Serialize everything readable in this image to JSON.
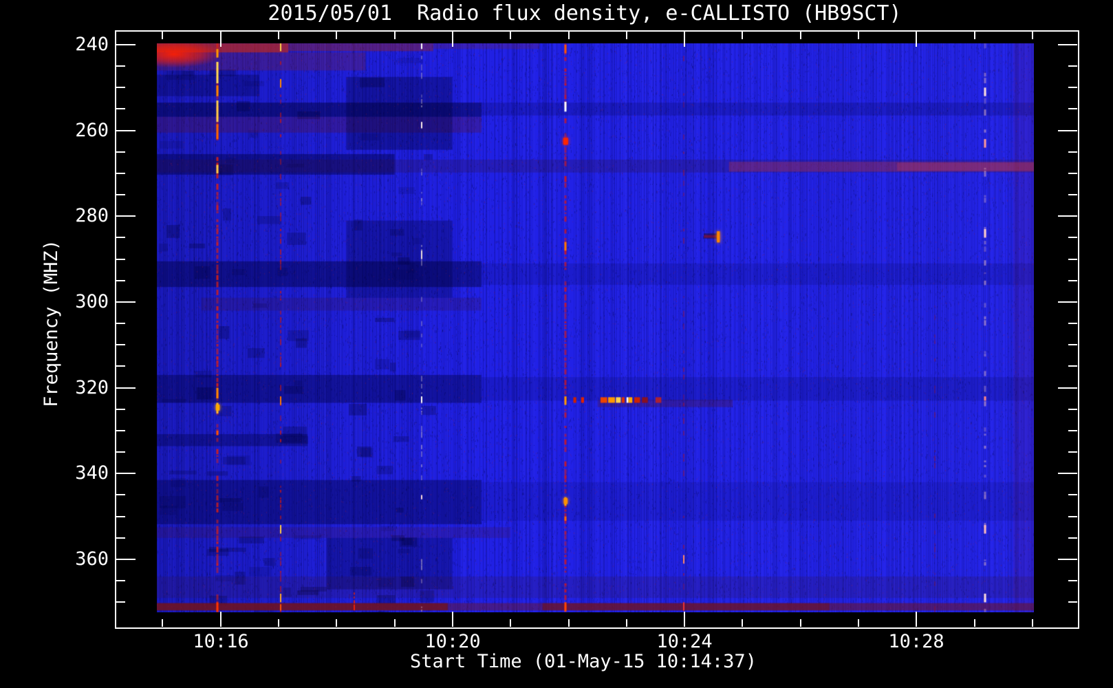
{
  "window": {
    "background": "#000000"
  },
  "chart_data": {
    "type": "heatmap",
    "title": "2015/05/01  Radio flux density, e-CALLISTO (HB9SCT)",
    "xlabel": "Start Time (01-May-15 10:14:37)",
    "ylabel": "Frequency (MHZ)",
    "station": "HB9SCT",
    "date": "2015/05/01",
    "start_time": "10:14:37",
    "background": "#2121e6",
    "x_ticks": [
      {
        "t": "10:16:00",
        "label": "10:16"
      },
      {
        "t": "10:20:00",
        "label": "10:20"
      },
      {
        "t": "10:24:00",
        "label": "10:24"
      },
      {
        "t": "10:28:00",
        "label": "10:28"
      }
    ],
    "x_minor": {
      "start": "10:15:00",
      "end": "10:30:00",
      "step_s": 60
    },
    "y_ticks": [
      {
        "f": 240,
        "label": "240"
      },
      {
        "f": 260,
        "label": "260"
      },
      {
        "f": 280,
        "label": "280"
      },
      {
        "f": 300,
        "label": "300"
      },
      {
        "f": 320,
        "label": "320"
      },
      {
        "f": 340,
        "label": "340"
      },
      {
        "f": 360,
        "label": "360"
      }
    ],
    "y_minor": {
      "start": 245,
      "end": 370,
      "step": 5
    },
    "y_range_mhz": [
      236.8,
      375.9
    ],
    "data_extent": {
      "t0": "10:14:54",
      "t1": "10:30:02",
      "f0": 239.7,
      "f1": 372.4
    },
    "blob": {
      "t": "10:15:12",
      "f": 242.2,
      "rx_s": 50,
      "ry_mhz": 3.2,
      "color": "#ff2000"
    },
    "bands": [
      {
        "t0": "10:14:54",
        "t1": "10:17:10",
        "f0": 239.7,
        "f1": 241.8,
        "color": "#c32611",
        "alpha": 0.7
      },
      {
        "t0": "10:17:10",
        "t1": "10:19:40",
        "f0": 239.7,
        "f1": 241.5,
        "color": "#a02010",
        "alpha": 0.4
      },
      {
        "t0": "10:19:40",
        "t1": "10:21:30",
        "f0": 239.7,
        "f1": 241.0,
        "color": "#901c10",
        "alpha": 0.2
      },
      {
        "t0": "10:14:54",
        "t1": "10:18:30",
        "f0": 241.8,
        "f1": 246.0,
        "color": "#8a1a10",
        "alpha": 0.25
      },
      {
        "t0": "10:14:54",
        "t1": "10:16:40",
        "f0": 247.0,
        "f1": 252.0,
        "color": "#000040",
        "alpha": 0.3
      },
      {
        "t0": "10:14:54",
        "t1": "10:20:30",
        "f0": 253.5,
        "f1": 256.8,
        "color": "#000040",
        "alpha": 0.5
      },
      {
        "t0": "10:20:30",
        "t1": "10:30:02",
        "f0": 253.5,
        "f1": 256.5,
        "color": "#000040",
        "alpha": 0.2
      },
      {
        "t0": "10:14:54",
        "t1": "10:20:30",
        "f0": 256.8,
        "f1": 260.5,
        "color": "#5a1030",
        "alpha": 0.3
      },
      {
        "t0": "10:14:54",
        "t1": "10:19:00",
        "f0": 265.5,
        "f1": 270.3,
        "color": "#000046",
        "alpha": 0.45
      },
      {
        "t0": "10:14:54",
        "t1": "10:30:02",
        "f0": 266.8,
        "f1": 269.8,
        "color": "#30103a",
        "alpha": 0.25
      },
      {
        "t0": "10:24:46",
        "t1": "10:30:02",
        "f0": 267.3,
        "f1": 269.6,
        "color": "#b03050",
        "alpha": 0.38
      },
      {
        "t0": "10:27:40",
        "t1": "10:30:02",
        "f0": 267.5,
        "f1": 269.4,
        "color": "#c23a55",
        "alpha": 0.3
      },
      {
        "t0": "10:14:54",
        "t1": "10:20:30",
        "f0": 290.5,
        "f1": 296.5,
        "color": "#000040",
        "alpha": 0.45
      },
      {
        "t0": "10:20:30",
        "t1": "10:30:02",
        "f0": 291.0,
        "f1": 296.0,
        "color": "#000040",
        "alpha": 0.15
      },
      {
        "t0": "10:15:40",
        "t1": "10:20:30",
        "f0": 299.0,
        "f1": 302.0,
        "color": "#40102a",
        "alpha": 0.2
      },
      {
        "t0": "10:14:54",
        "t1": "10:20:30",
        "f0": 317.0,
        "f1": 323.5,
        "color": "#000040",
        "alpha": 0.4
      },
      {
        "t0": "10:20:30",
        "t1": "10:30:02",
        "f0": 317.5,
        "f1": 323.0,
        "color": "#000040",
        "alpha": 0.16
      },
      {
        "t0": "10:22:30",
        "t1": "10:24:50",
        "f0": 322.8,
        "f1": 324.5,
        "color": "#50122c",
        "alpha": 0.3
      },
      {
        "t0": "10:14:54",
        "t1": "10:17:30",
        "f0": 330.8,
        "f1": 333.6,
        "color": "#000040",
        "alpha": 0.35
      },
      {
        "t0": "10:14:54",
        "t1": "10:20:30",
        "f0": 341.5,
        "f1": 351.8,
        "color": "#000042",
        "alpha": 0.4
      },
      {
        "t0": "10:20:30",
        "t1": "10:30:02",
        "f0": 342.0,
        "f1": 351.0,
        "color": "#000040",
        "alpha": 0.12
      },
      {
        "t0": "10:14:54",
        "t1": "10:21:00",
        "f0": 352.5,
        "f1": 355.0,
        "color": "#4a1028",
        "alpha": 0.2
      },
      {
        "t0": "10:18:10",
        "t1": "10:20:00",
        "f0": 247.5,
        "f1": 264.5,
        "color": "#000038",
        "alpha": 0.35
      },
      {
        "t0": "10:18:10",
        "t1": "10:20:00",
        "f0": 281.0,
        "f1": 299.0,
        "color": "#000038",
        "alpha": 0.3
      },
      {
        "t0": "10:17:50",
        "t1": "10:20:00",
        "f0": 355.0,
        "f1": 367.0,
        "color": "#000038",
        "alpha": 0.3
      },
      {
        "t0": "10:14:54",
        "t1": "10:30:02",
        "f0": 364.0,
        "f1": 369.0,
        "color": "#3a0f28",
        "alpha": 0.18
      },
      {
        "t0": "10:24:20",
        "t1": "10:24:34",
        "f0": 284.0,
        "f1": 285.2,
        "color": "#2a0816",
        "alpha": 0.5
      },
      {
        "t0": "10:24:20",
        "t1": "10:24:34",
        "f0": 284.4,
        "f1": 285.0,
        "color": "#aa1020",
        "alpha": 0.5
      },
      {
        "t0": "10:29:40",
        "t1": "10:30:02",
        "f0": 239.7,
        "f1": 372.4,
        "color": "#701030",
        "alpha": 0.12
      }
    ],
    "bottom_band": {
      "f0": 370.2,
      "f1": 371.9,
      "color": "#6e1322",
      "segments": [
        {
          "t0": "10:14:54",
          "t1": "10:19:55",
          "alpha": 0.9
        },
        {
          "t0": "10:19:55",
          "t1": "10:21:33",
          "alpha": 0.45
        },
        {
          "t0": "10:21:33",
          "t1": "10:26:30",
          "alpha": 0.8
        },
        {
          "t0": "10:26:30",
          "t1": "10:30:02",
          "alpha": 0.55
        }
      ]
    },
    "vlines": [
      {
        "t": "10:15:57",
        "color": "#e02010",
        "width": 3,
        "density": 0.85,
        "alpha": 0.9,
        "highlights": [
          [
            241,
            243,
            "#ff9a00"
          ],
          [
            244,
            249,
            "#ffdd55"
          ],
          [
            249.5,
            252,
            "#ff8800"
          ],
          [
            253,
            258,
            "#ffcf4a"
          ],
          [
            258.5,
            262,
            "#ff6600"
          ],
          [
            268,
            270,
            "#ffcc44"
          ],
          [
            320,
            322.5,
            "#ff8800"
          ],
          [
            323.5,
            326,
            "#ffbb33"
          ],
          [
            330,
            331,
            "#ff5500"
          ],
          [
            370,
            372.2,
            "#ff3300"
          ]
        ]
      },
      {
        "t": "10:17:02",
        "color": "#cc1810",
        "width": 2,
        "density": 0.55,
        "alpha": 0.8,
        "highlights": [
          [
            239.7,
            241.5,
            "#ffd24a"
          ],
          [
            248,
            250,
            "#ff8800"
          ],
          [
            322,
            324,
            "#ff7700"
          ],
          [
            352,
            354,
            "#ffcc44"
          ],
          [
            368,
            370,
            "#ffaa22"
          ],
          [
            370.5,
            372,
            "#ff5500"
          ]
        ]
      },
      {
        "t": "10:18:18",
        "color": "#ff2200",
        "width": 2,
        "density": 0.9,
        "alpha": 0.9,
        "f0": 367,
        "f1": 372.4,
        "highlights": []
      },
      {
        "t": "10:19:28",
        "color": "#d8c8d8",
        "width": 2,
        "density": 0.35,
        "alpha": 0.5,
        "highlights": [
          [
            239.7,
            241,
            "#ffffff"
          ],
          [
            258,
            259.5,
            "#ffeeee"
          ],
          [
            288,
            290,
            "#eedddd"
          ],
          [
            322,
            323.5,
            "#ffffff"
          ],
          [
            345,
            346,
            "#ffdddd"
          ]
        ]
      },
      {
        "t": "10:21:57",
        "color": "#dd1510",
        "width": 3,
        "density": 0.8,
        "alpha": 0.85,
        "highlights": [
          [
            240,
            242,
            "#ff5500"
          ],
          [
            253.3,
            255.6,
            "#ffffff"
          ],
          [
            286,
            288,
            "#ff7700"
          ],
          [
            322,
            324,
            "#ff9900"
          ],
          [
            345.5,
            347.5,
            "#ffaa00"
          ],
          [
            350,
            351,
            "#ff6600"
          ],
          [
            370,
            372.2,
            "#ff4400"
          ]
        ]
      },
      {
        "t": "10:23:59",
        "color": "#b01020",
        "width": 2,
        "density": 0.3,
        "alpha": 0.5,
        "highlights": [
          [
            359,
            361,
            "#ff8866"
          ],
          [
            370,
            372,
            "#ee3333"
          ]
        ]
      },
      {
        "t": "10:28:19",
        "color": "#aa1020",
        "width": 2,
        "density": 0.25,
        "alpha": 0.4,
        "f0": 300,
        "f1": 372.4,
        "highlights": []
      },
      {
        "t": "10:29:11",
        "color": "#e8b8c8",
        "width": 3,
        "density": 0.4,
        "alpha": 0.55,
        "highlights": [
          [
            250,
            252,
            "#ffdddd"
          ],
          [
            262,
            264,
            "#ff9999"
          ],
          [
            283,
            285,
            "#ffcccc"
          ],
          [
            322,
            323,
            "#ff8888"
          ],
          [
            352,
            354,
            "#ffbbbb"
          ],
          [
            368,
            370,
            "#ffdddd"
          ]
        ]
      }
    ],
    "burst": {
      "f0": 322.2,
      "f1": 323.5,
      "dashes": [
        [
          "10:22:05",
          "10:22:08",
          "#cc2200"
        ],
        [
          "10:22:13",
          "10:22:16",
          "#dd2200"
        ],
        [
          "10:22:33",
          "10:22:40",
          "#ee4400"
        ],
        [
          "10:22:41",
          "10:22:48",
          "#ff9900"
        ],
        [
          "10:22:49",
          "10:22:54",
          "#ffd24a"
        ],
        [
          "10:22:55",
          "10:22:58",
          "#dd3300"
        ],
        [
          "10:23:00",
          "10:23:02",
          "#ffffff"
        ],
        [
          "10:23:02",
          "10:23:06",
          "#ffaa00"
        ],
        [
          "10:23:08",
          "10:23:14",
          "#cc2200"
        ],
        [
          "10:23:16",
          "10:23:22",
          "#881122"
        ],
        [
          "10:23:30",
          "10:23:36",
          "#aa2233"
        ]
      ]
    },
    "spots": [
      {
        "t": "10:21:57",
        "f": 262.5,
        "w_s": 5,
        "h_mhz": 1.6,
        "color": "#ff2600"
      },
      {
        "t": "10:21:57",
        "f": 346.4,
        "w_s": 4,
        "h_mhz": 1.4,
        "color": "#ff9100"
      },
      {
        "t": "10:24:35",
        "f": 284.8,
        "w_s": 3,
        "h_mhz": 2.6,
        "color": "#ff8800"
      },
      {
        "t": "10:15:57",
        "f": 324.6,
        "w_s": 4,
        "h_mhz": 1.4,
        "color": "#ffaa00"
      }
    ]
  }
}
